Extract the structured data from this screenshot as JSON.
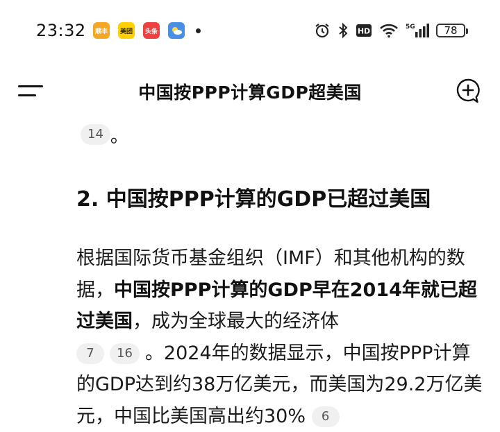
{
  "status_bar": {
    "time": "23:32",
    "app_icons": [
      {
        "name": "shunfeng-app-icon",
        "label": "顺丰",
        "bg": "#f5a623",
        "fg": "#ffffff"
      },
      {
        "name": "meituan-app-icon",
        "label": "美团",
        "bg": "#ffd100",
        "fg": "#222222"
      },
      {
        "name": "toutiao-app-icon",
        "label": "头条",
        "bg": "#f04142",
        "fg": "#ffffff"
      },
      {
        "name": "weather-app-icon",
        "label": "",
        "bg": "#4a90e2",
        "fg": "#ffffff"
      }
    ],
    "hd_label": "HD",
    "network_label": "5G",
    "battery": "78"
  },
  "header": {
    "title": "中国按PPP计算GDP超美国"
  },
  "content": {
    "prev_citation": "14",
    "prev_tail": "。",
    "section_heading": "2. 中国按PPP计算的GDP已超过美国",
    "para": {
      "t1": "根据国际货币基金组织（IMF）和其他机构的数据，",
      "b1": "中国按PPP计算的GDP早在2014年就已超过美国",
      "t2": "，成为全球最大的经济体",
      "c1": "7",
      "c2": "16",
      "t3": "。2024年的数据显示，中国按PPP计算的GDP达到约38万亿美元，而美国为29.2万亿美元，中国比美国高出约30%",
      "c3": "6"
    }
  },
  "colors": {
    "text": "#1a1a1a",
    "citation_bg": "#f0f0f0",
    "citation_text": "#555555"
  }
}
